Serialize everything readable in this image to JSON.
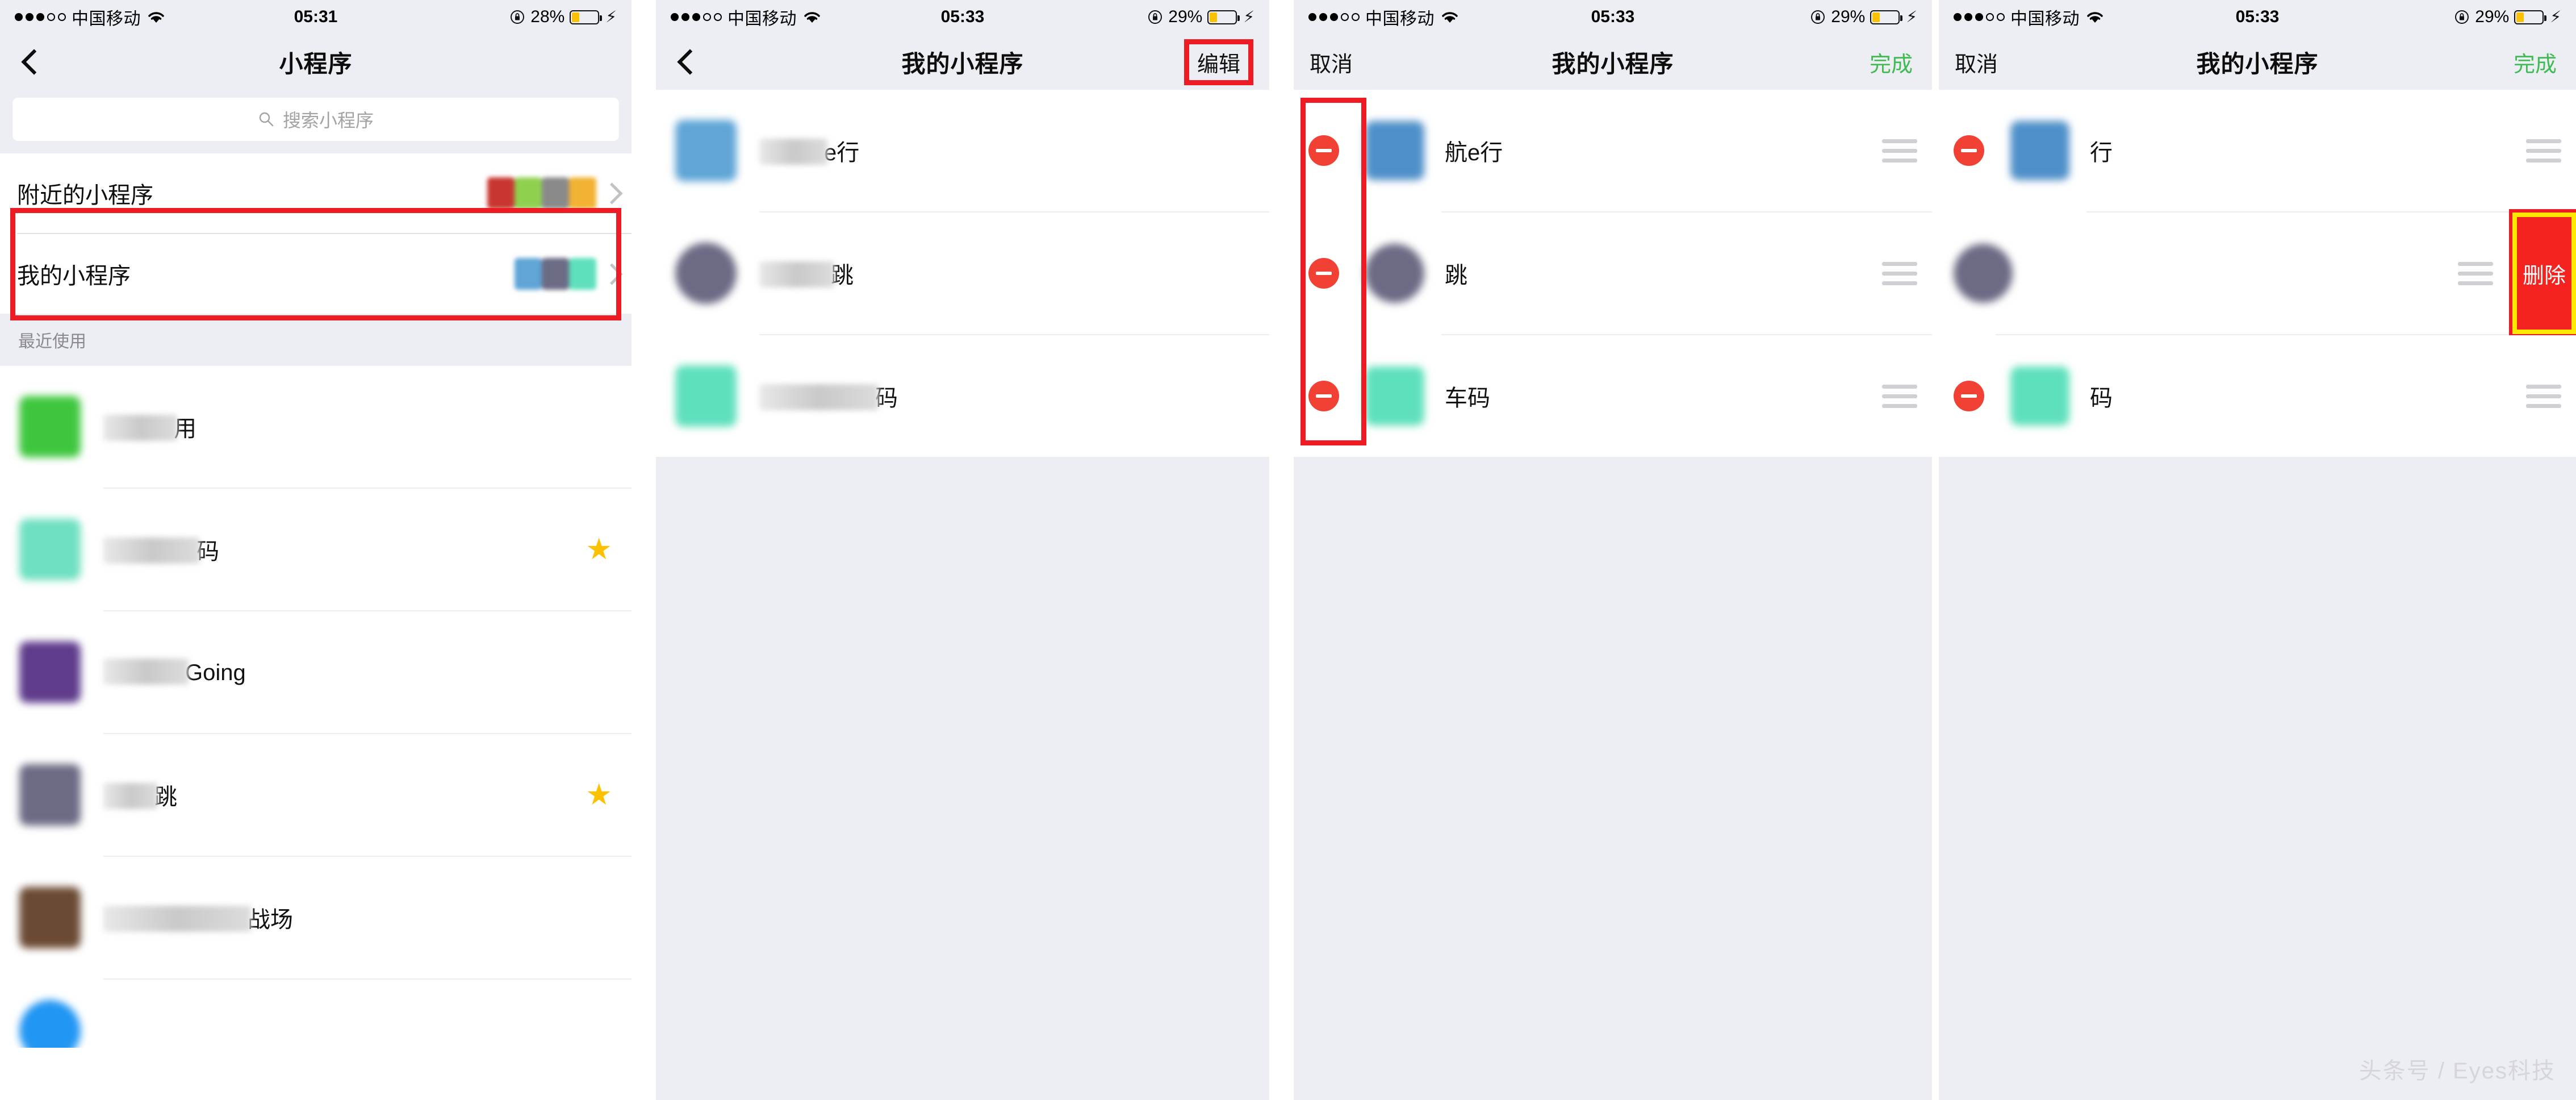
{
  "panels": [
    {
      "id": "mini-program-home",
      "status": {
        "carrier": "中国移动",
        "signal_dots": "●●●○○",
        "time": "05:31",
        "battery_pct": "28%",
        "battery_level": 28
      },
      "nav": {
        "title": "小程序",
        "back": "‹",
        "right_label": ""
      },
      "search": {
        "placeholder": "搜索小程序"
      },
      "entries": [
        {
          "label": "附近的小程序",
          "highlighted": false
        },
        {
          "label": "我的小程序",
          "highlighted": true
        }
      ],
      "section_title": "最近使用",
      "apps": [
        {
          "name_suffix": "用",
          "starred": false,
          "icon_color": "#3ec73e"
        },
        {
          "name_suffix": "码",
          "starred": true,
          "icon_color": "#6fe0c2"
        },
        {
          "name_suffix": "Going",
          "starred": false,
          "icon_color": "#5f3c8c"
        },
        {
          "name_suffix": "跳",
          "starred": true,
          "icon_color": "#6b6b85"
        },
        {
          "name_suffix": "战场",
          "starred": false,
          "icon_color": "#6b4a33"
        }
      ]
    },
    {
      "id": "my-mini-programs",
      "status": {
        "carrier": "中国移动",
        "signal_dots": "●●●○○",
        "time": "05:33",
        "battery_pct": "29%",
        "battery_level": 29
      },
      "nav": {
        "title": "我的小程序",
        "back": "‹",
        "right_label": "编辑",
        "right_boxed": true
      },
      "apps": [
        {
          "name_suffix": "e行",
          "icon_color": "#5fa5d6"
        },
        {
          "name_suffix": "跳",
          "icon_color": "#6b6b85"
        },
        {
          "name_suffix": "码",
          "icon_color": "#5fe0bd"
        }
      ]
    },
    {
      "id": "my-mini-programs-editing",
      "status": {
        "carrier": "中国移动",
        "signal_dots": "●●●○○",
        "time": "05:33",
        "battery_pct": "29%",
        "battery_level": 29
      },
      "nav": {
        "title": "我的小程序",
        "left_label": "取消",
        "right_label": "完成"
      },
      "delete_column_highlighted": true,
      "apps": [
        {
          "name_suffix": "航e行",
          "icon_color": "#4f8fc9"
        },
        {
          "name_suffix": "跳",
          "icon_color": "#6b6b85"
        },
        {
          "name_suffix": "车码",
          "icon_color": "#5fe0bd"
        }
      ]
    },
    {
      "id": "my-mini-programs-swipe-delete",
      "status": {
        "carrier": "中国移动",
        "signal_dots": "●●●○○",
        "time": "05:33",
        "battery_pct": "29%",
        "battery_level": 29
      },
      "nav": {
        "title": "我的小程序",
        "left_label": "取消",
        "right_label": "完成"
      },
      "delete_button_label": "删除",
      "apps": [
        {
          "name_suffix": "行",
          "icon_color": "#4f8fc9",
          "swiped": false
        },
        {
          "name_suffix": "",
          "icon_color": "#6b6b85",
          "swiped": true
        },
        {
          "name_suffix": "码",
          "icon_color": "#5fe0bd",
          "swiped": false
        }
      ]
    }
  ],
  "colors": {
    "highlight_red": "#ed1c24",
    "highlight_yellow": "#ffe800",
    "delete_red": "#f5231f",
    "minus_red": "#f04134",
    "done_green": "#3fbb54",
    "star_yellow": "#fcc200",
    "battery_yellow": "#fcc200",
    "bg_gray": "#eceef3"
  },
  "watermark": "头条号 / Eyes科技"
}
